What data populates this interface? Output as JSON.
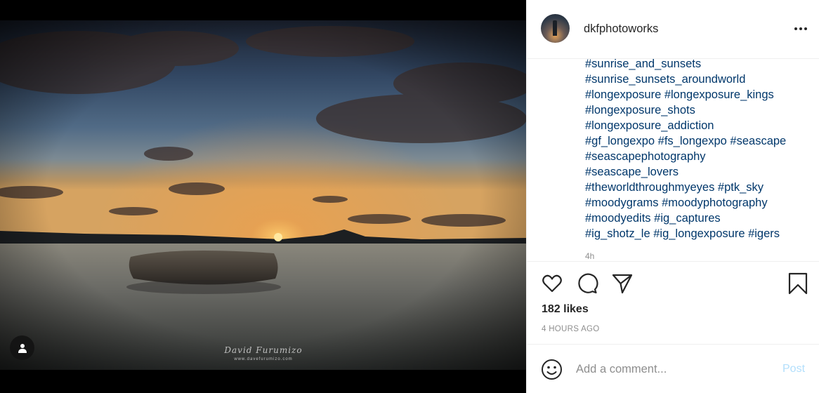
{
  "post": {
    "username": "dkfphotoworks",
    "caption_lines": [
      "#sunrise_and_sunsets",
      "#sunrise_sunsets_aroundworld",
      "#longexposure #longexposure_kings",
      "#longexposure_shots",
      "#longexposure_addiction",
      "#gf_longexpo #fs_longexpo #seascape",
      "#seascapephotography",
      "#seascape_lovers",
      "#theworldthroughmyeyes #ptk_sky",
      "#moodygrams #moodyphotography",
      "#moodyedits #ig_captures",
      "#ig_shotz_le #ig_longexposure #igers"
    ],
    "timestamp_short": "4h",
    "likes": "182 likes",
    "time_ago": "4 HOURS AGO"
  },
  "photo": {
    "watermark_signature": "David Furumizo",
    "watermark_url": "www.davefurumizo.com"
  },
  "comment": {
    "placeholder": "Add a comment...",
    "post_label": "Post"
  },
  "icons": {
    "more": "more-options-icon",
    "like": "heart-icon",
    "comment": "comment-bubble-icon",
    "share": "paper-plane-icon",
    "save": "bookmark-icon",
    "emoji": "emoji-icon",
    "user_tag": "person-icon"
  },
  "colors": {
    "hashtag": "#00376b",
    "text": "#262626",
    "muted": "#8e8e8e",
    "post_button_disabled": "#b2dffc"
  }
}
